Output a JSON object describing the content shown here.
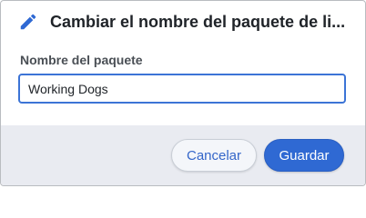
{
  "dialog": {
    "title": "Cambiar el nombre del paquete de li...",
    "title_icon": "pencil-icon",
    "accent_color": "#2f69d3"
  },
  "form": {
    "field_label": "Nombre del paquete",
    "field_value": "Working Dogs"
  },
  "footer": {
    "cancel_label": "Cancelar",
    "save_label": "Guardar"
  }
}
